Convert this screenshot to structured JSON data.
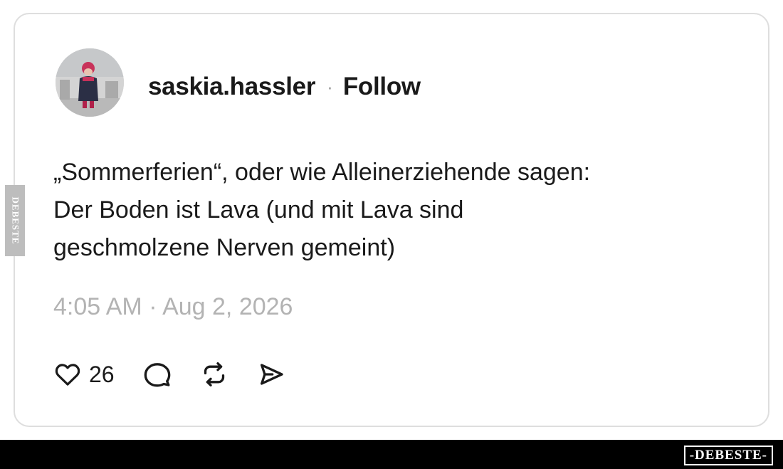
{
  "post": {
    "username": "saskia.hassler",
    "separator": "·",
    "follow_label": "Follow",
    "text_lines": [
      "„Sommerferien“, oder wie Alleinerziehende sagen:",
      "Der Boden ist Lava (und mit Lava sind",
      "geschmolzene Nerven gemeint)"
    ],
    "timestamp": "4:05 AM · Aug 2, 2026",
    "likes": "26"
  },
  "actions": {
    "icons": [
      "heart-icon",
      "comment-icon",
      "repost-icon",
      "share-icon"
    ]
  },
  "watermark": {
    "side_text": "DEBESTE",
    "bottom_text": "-DEBESTE-"
  },
  "colors": {
    "text": "#1a1a1a",
    "muted": "#b3b3b3",
    "card_border": "#dedede",
    "bar": "#000000"
  }
}
